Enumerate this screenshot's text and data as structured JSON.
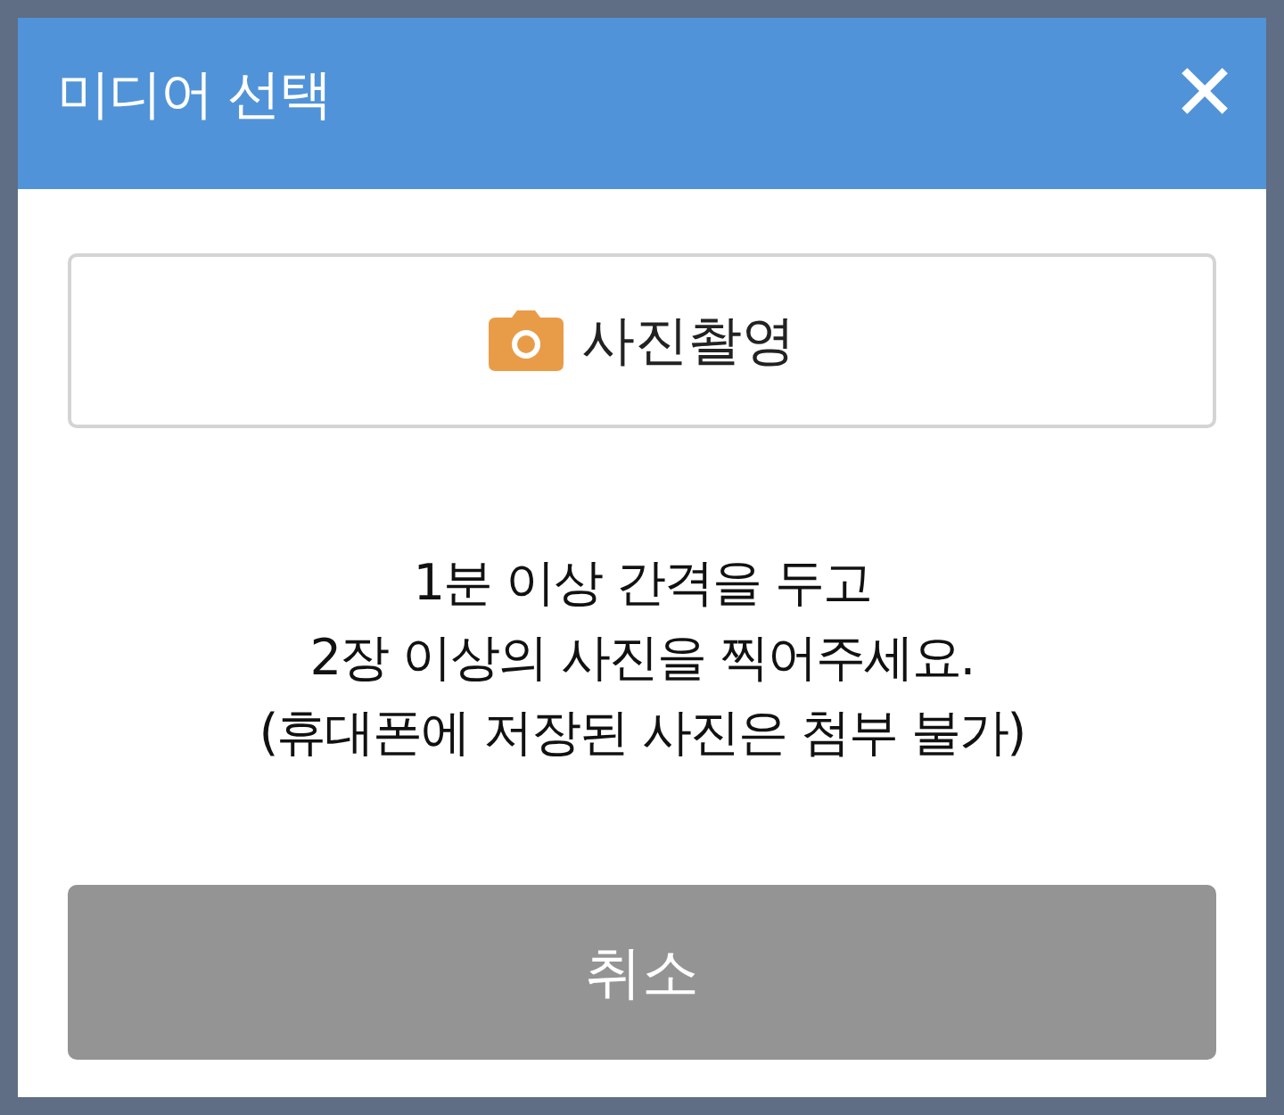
{
  "dialog": {
    "title": "미디어 선택",
    "close_glyph": "✕"
  },
  "photo_button": {
    "label": "사진촬영"
  },
  "message_lines": [
    "1분 이상 간격을 두고",
    "2장 이상의 사진을 찍어주세요.",
    "(휴대폰에 저장된 사진은 첨부 불가)"
  ],
  "cancel_button": {
    "label": "취소"
  }
}
